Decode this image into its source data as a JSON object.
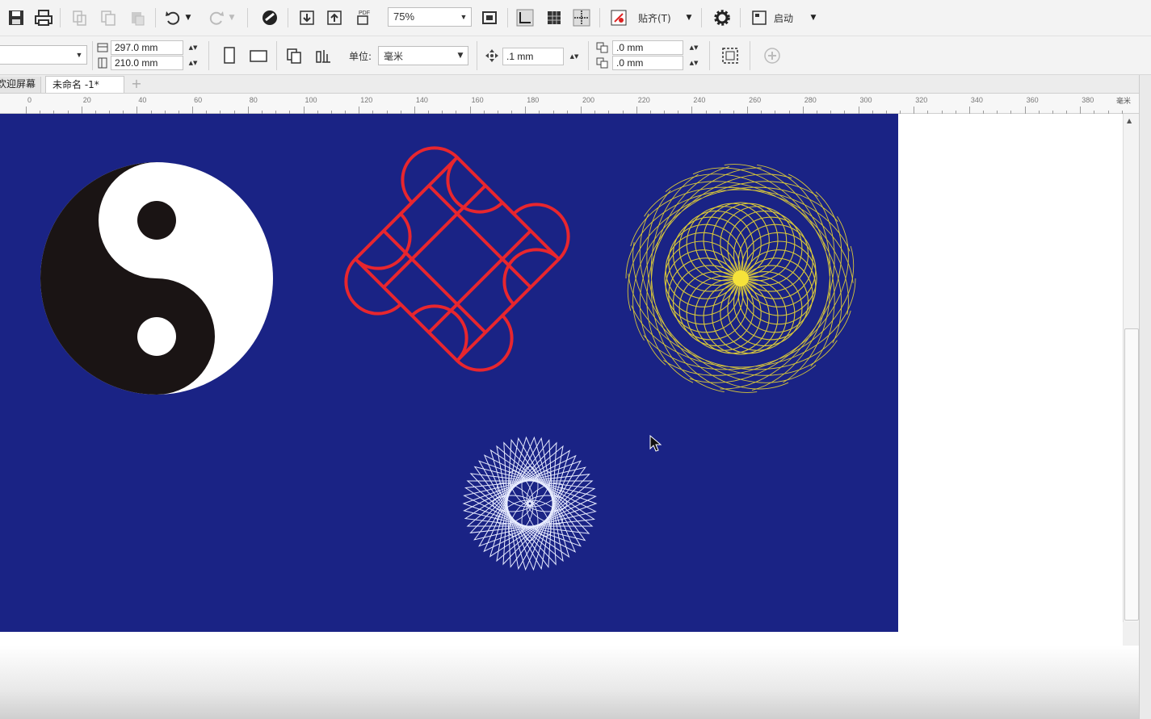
{
  "toolbar": {
    "zoom_value": "75%",
    "snap_label": "贴齐(T)",
    "launch_label": "启动"
  },
  "property_bar": {
    "page_width": "297.0 mm",
    "page_height": "210.0 mm",
    "unit_label": "单位:",
    "unit_value": "毫米",
    "nudge_value": ".1 mm",
    "dup_x": ".0 mm",
    "dup_y": ".0 mm"
  },
  "tabs": [
    {
      "label": "欢迎屏幕"
    },
    {
      "label": "未命名 -1*"
    }
  ],
  "ruler": {
    "labels": [
      "0",
      "20",
      "40",
      "60",
      "80",
      "100",
      "120",
      "140",
      "160",
      "180",
      "200",
      "220",
      "240",
      "260",
      "280",
      "300",
      "320",
      "340",
      "360",
      "380"
    ],
    "unit": "毫米"
  },
  "canvas": {
    "page_color": "#1a2385",
    "taiji_dark": "#1a1414",
    "knot_color": "#e8262e",
    "spiro_color": "#d8c73a",
    "star_color": "#e8ecff"
  }
}
